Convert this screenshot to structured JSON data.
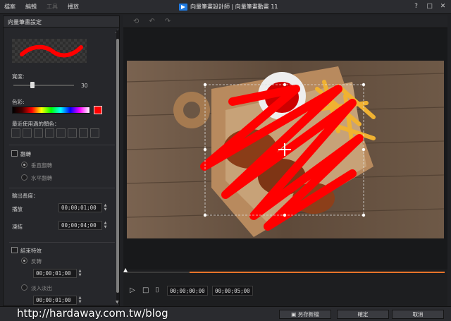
{
  "menu": {
    "file": "檔案",
    "edit": "編輯",
    "tools": "工具",
    "play": "播放"
  },
  "window": {
    "title": "向量筆畫設計師 | 向量筆畫動畫 11",
    "help": "?",
    "restore": "□",
    "close": "✕"
  },
  "panel": {
    "title": "向量筆畫設定",
    "width_label": "寬度:",
    "width_value": "30",
    "color_label": "色彩:",
    "recent_label": "最近使用過的顏色：",
    "flip_label": "翻轉",
    "vertical_flip": "垂直翻轉",
    "horizontal_flip": "水平翻轉",
    "output_length_label": "輸出長度：",
    "playback_label": "播放",
    "playback_time": "00;00;01;00",
    "hold_label": "凍結",
    "hold_time": "00;00;04;00",
    "end_effect_label": "結束特效",
    "reverse_label": "反轉",
    "reverse_time": "00;00;01;00",
    "fade_label": "淡入淡出",
    "fade_time": "00;00;01;00"
  },
  "colors": {
    "accent": "#e8742a",
    "brush": "#ff0000"
  },
  "viewer": {
    "current_time": "00;00;00;00",
    "total_time": "00;00;05;00",
    "progress_start": 0.2
  },
  "footer": {
    "save_new": "另存新檔",
    "ok": "確定",
    "cancel": "取消"
  },
  "watermark": "http://hardaway.com.tw/blog"
}
